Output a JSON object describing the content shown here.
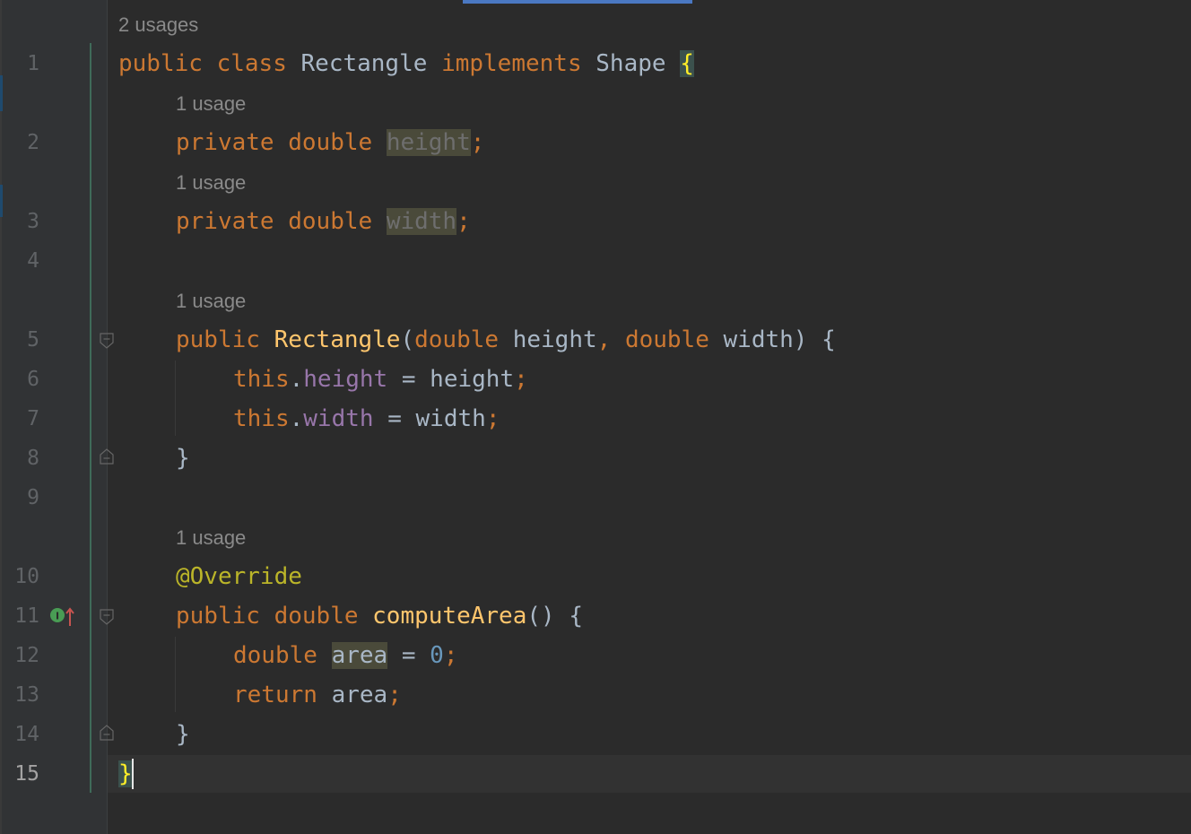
{
  "editor": {
    "language": "Java",
    "current_line": "15",
    "line_numbers": [
      "1",
      "2",
      "3",
      "4",
      "5",
      "6",
      "7",
      "8",
      "9",
      "10",
      "11",
      "12",
      "13",
      "14",
      "15"
    ],
    "hints": {
      "class_usages": "2 usages",
      "height_usage": "1 usage",
      "width_usage": "1 usage",
      "constructor_usage": "1 usage",
      "method_usage": "1 usage"
    },
    "tokens": {
      "public": "public",
      "class": "class",
      "class_name": "Rectangle",
      "implements": "implements",
      "interface_name": "Shape",
      "open_brace": "{",
      "close_brace": "}",
      "private": "private",
      "double": "double",
      "height": "height",
      "width": "width",
      "semicolon": ";",
      "comma": ",",
      "open_paren": "(",
      "close_paren": ")",
      "this": "this",
      "dot": ".",
      "equals": "=",
      "override": "@Override",
      "method_name": "computeArea",
      "empty_parens": "()",
      "area": "area",
      "zero": "0",
      "return": "return"
    },
    "colors": {
      "background": "#2b2b2b",
      "gutter": "#313335",
      "keyword": "#cc7832",
      "method": "#ffc66d",
      "field": "#9876aa",
      "number": "#6897bb",
      "annotation": "#bbb529",
      "text": "#a9b7c6"
    },
    "icons": {
      "implements_gutter": "implements-interface-icon",
      "fold": "fold-marker-icon"
    }
  }
}
